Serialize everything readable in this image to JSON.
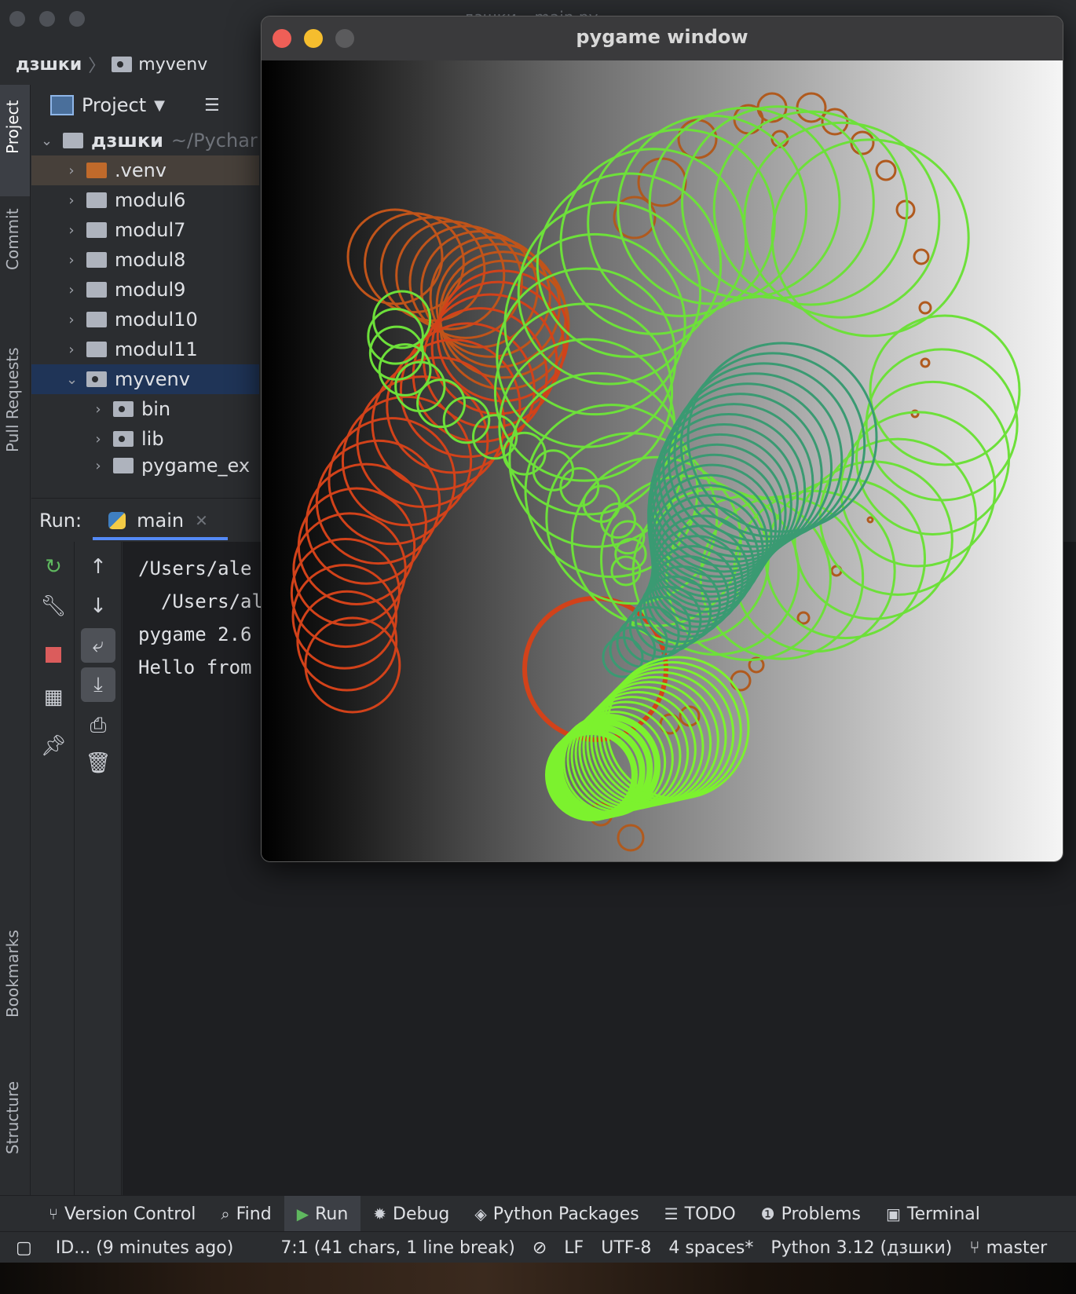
{
  "ide": {
    "title": "дзшки – main.py",
    "breadcrumb": {
      "root": "дзшки",
      "child": "myvenv"
    },
    "stripe_left": {
      "project": "Project",
      "commit": "Commit",
      "pull_requests": "Pull Requests",
      "bookmarks": "Bookmarks",
      "structure": "Structure"
    },
    "project_panel": {
      "title": "Project",
      "root": {
        "name": "дзшки",
        "hint": "~/Pychar"
      },
      "items": [
        {
          "name": ".venv"
        },
        {
          "name": "modul6"
        },
        {
          "name": "modul7"
        },
        {
          "name": "modul8"
        },
        {
          "name": "modul9"
        },
        {
          "name": "modul10"
        },
        {
          "name": "modul11"
        },
        {
          "name": "myvenv"
        },
        {
          "name": "bin"
        },
        {
          "name": "lib"
        },
        {
          "name": "pygame_ex"
        }
      ]
    },
    "run": {
      "label": "Run:",
      "tab": "main",
      "lines": [
        "/Users/ale",
        "  /Users/al",
        "pygame 2.6",
        "Hello from"
      ]
    },
    "bottom_tabs": [
      "Version Control",
      "Find",
      "Run",
      "Debug",
      "Python Packages",
      "TODO",
      "Problems",
      "Terminal"
    ],
    "status": {
      "message": "ID... (9 minutes ago)",
      "position": "7:1 (41 chars, 1 line break)",
      "line_sep": "LF",
      "encoding": "UTF-8",
      "indent": "4 spaces*",
      "interpreter": "Python 3.12 (дзшки)",
      "branch": "master"
    }
  },
  "pygame": {
    "title": "pygame window",
    "colors": {
      "orange": "#c0541a",
      "brown_orange": "#b05a1e",
      "green": "#6de03a",
      "bright_green": "#7cf22e",
      "teal": "#3a9a72",
      "red": "#d2421a"
    }
  }
}
